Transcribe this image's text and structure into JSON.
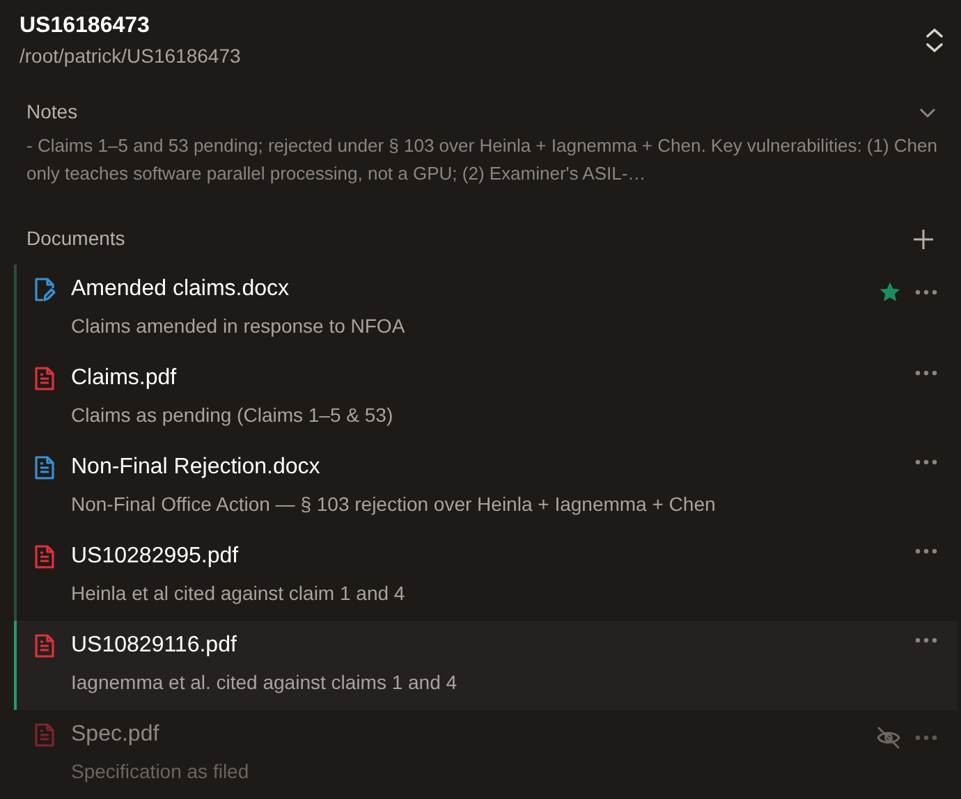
{
  "header": {
    "title": "US16186473",
    "path": "/root/patrick/US16186473"
  },
  "notes": {
    "label": "Notes",
    "expanded": true,
    "text": "- Claims 1–5 and 53 pending; rejected under § 103 over Heinla + Iagnemma + Chen. Key vulnerabilities: (1) Chen only teaches software parallel processing, not a GPU; (2) Examiner's ASIL-…"
  },
  "documents": {
    "label": "Documents",
    "items": [
      {
        "name": "Amended claims.docx",
        "description": "Claims amended in response to NFOA",
        "kind": "edited-doc",
        "starred": true,
        "selected": false,
        "hidden": false
      },
      {
        "name": "Claims.pdf",
        "description": "Claims as pending (Claims 1–5 & 53)",
        "kind": "pdf",
        "starred": false,
        "selected": false,
        "hidden": false
      },
      {
        "name": "Non-Final Rejection.docx",
        "description": "Non-Final Office Action — § 103 rejection over Heinla + Iagnemma + Chen",
        "kind": "doc",
        "starred": false,
        "selected": false,
        "hidden": false
      },
      {
        "name": "US10282995.pdf",
        "description": "Heinla et al cited against claim 1 and 4",
        "kind": "pdf",
        "starred": false,
        "selected": false,
        "hidden": false
      },
      {
        "name": "US10829116.pdf",
        "description": "Iagnemma et al. cited against claims 1 and 4",
        "kind": "pdf",
        "starred": false,
        "selected": true,
        "hidden": false
      },
      {
        "name": "Spec.pdf",
        "description": "Specification as filed",
        "kind": "pdf",
        "starred": false,
        "selected": false,
        "hidden": true
      }
    ]
  }
}
